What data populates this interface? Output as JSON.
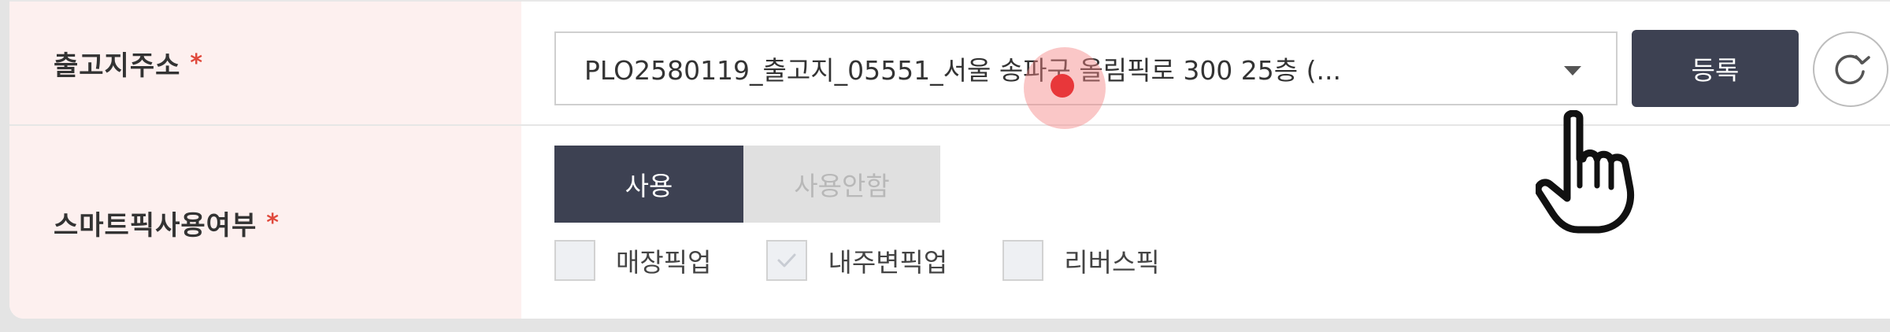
{
  "form": {
    "rows": [
      {
        "label": "출고지주소",
        "required_mark": "*",
        "select_value": "PLO2580119_출고지_05551_서울 송파구 올림픽로 300 25층 (...",
        "register_button": "등록"
      },
      {
        "label": "스마트픽사용여부",
        "required_mark": "*",
        "toggle": {
          "on_label": "사용",
          "off_label": "사용안함",
          "selected": "사용"
        },
        "checkboxes": [
          {
            "label": "매장픽업",
            "checked": false
          },
          {
            "label": "내주변픽업",
            "checked": true
          },
          {
            "label": "리버스픽",
            "checked": false
          }
        ]
      }
    ]
  },
  "icons": {
    "dropdown": "chevron-down-icon",
    "refresh": "refresh-icon",
    "cursor": "hand-pointer-icon"
  },
  "colors": {
    "label_bg": "#fdf0ef",
    "required": "#e0493c",
    "primary_button": "#3d4152",
    "inactive_toggle": "#e0e0e0",
    "click_highlight": "#e8373a"
  }
}
